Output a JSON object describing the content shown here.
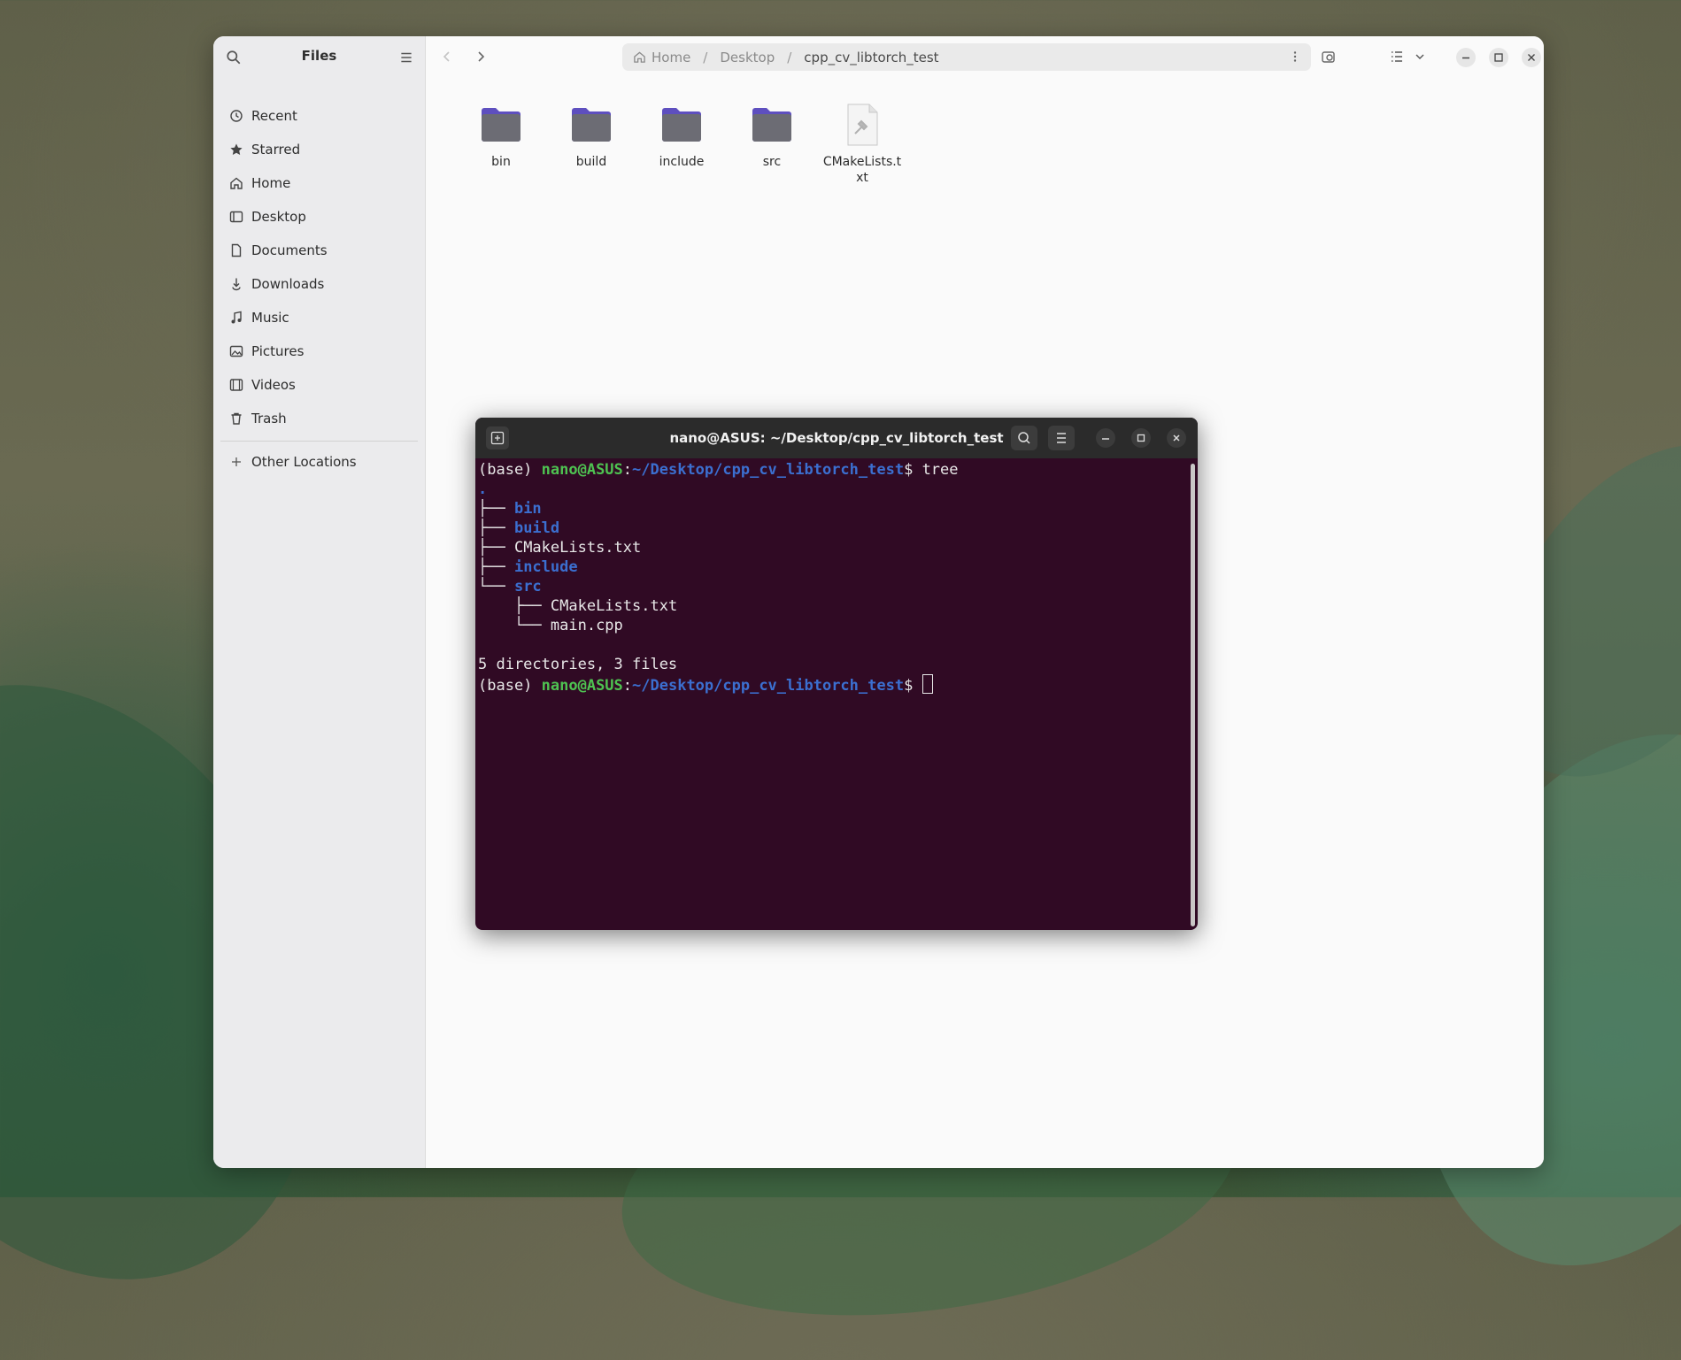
{
  "files": {
    "sidebar": {
      "title": "Files",
      "items": [
        {
          "label": "Recent",
          "icon": "clock-icon"
        },
        {
          "label": "Starred",
          "icon": "star-icon"
        },
        {
          "label": "Home",
          "icon": "home-icon"
        },
        {
          "label": "Desktop",
          "icon": "desktop-icon"
        },
        {
          "label": "Documents",
          "icon": "document-icon"
        },
        {
          "label": "Downloads",
          "icon": "download-icon"
        },
        {
          "label": "Music",
          "icon": "music-icon"
        },
        {
          "label": "Pictures",
          "icon": "picture-icon"
        },
        {
          "label": "Videos",
          "icon": "video-icon"
        },
        {
          "label": "Trash",
          "icon": "trash-icon"
        }
      ],
      "other_locations": "Other Locations"
    },
    "path": {
      "home": "Home",
      "desktop": "Desktop",
      "current": "cpp_cv_libtorch_test"
    },
    "items": [
      {
        "name": "bin",
        "kind": "folder"
      },
      {
        "name": "build",
        "kind": "folder"
      },
      {
        "name": "include",
        "kind": "folder"
      },
      {
        "name": "src",
        "kind": "folder"
      },
      {
        "name": "CMakeLists.txt",
        "kind": "text-file"
      }
    ],
    "folder_color": "#5e4fbf"
  },
  "terminal": {
    "title": "nano@ASUS: ~/Desktop/cpp_cv_libtorch_test",
    "prompt_env": "(base) ",
    "prompt_user": "nano@ASUS",
    "prompt_path": "~/Desktop/cpp_cv_libtorch_test",
    "command": "tree",
    "tree_root": ".",
    "tree": [
      {
        "prefix": "├── ",
        "name": "bin",
        "dir": true
      },
      {
        "prefix": "├── ",
        "name": "build",
        "dir": true
      },
      {
        "prefix": "├── ",
        "name": "CMakeLists.txt",
        "dir": false
      },
      {
        "prefix": "├── ",
        "name": "include",
        "dir": true
      },
      {
        "prefix": "└── ",
        "name": "src",
        "dir": true
      },
      {
        "prefix": "    ├── ",
        "name": "CMakeLists.txt",
        "dir": false
      },
      {
        "prefix": "    └── ",
        "name": "main.cpp",
        "dir": false
      }
    ],
    "summary": "5 directories, 3 files"
  }
}
